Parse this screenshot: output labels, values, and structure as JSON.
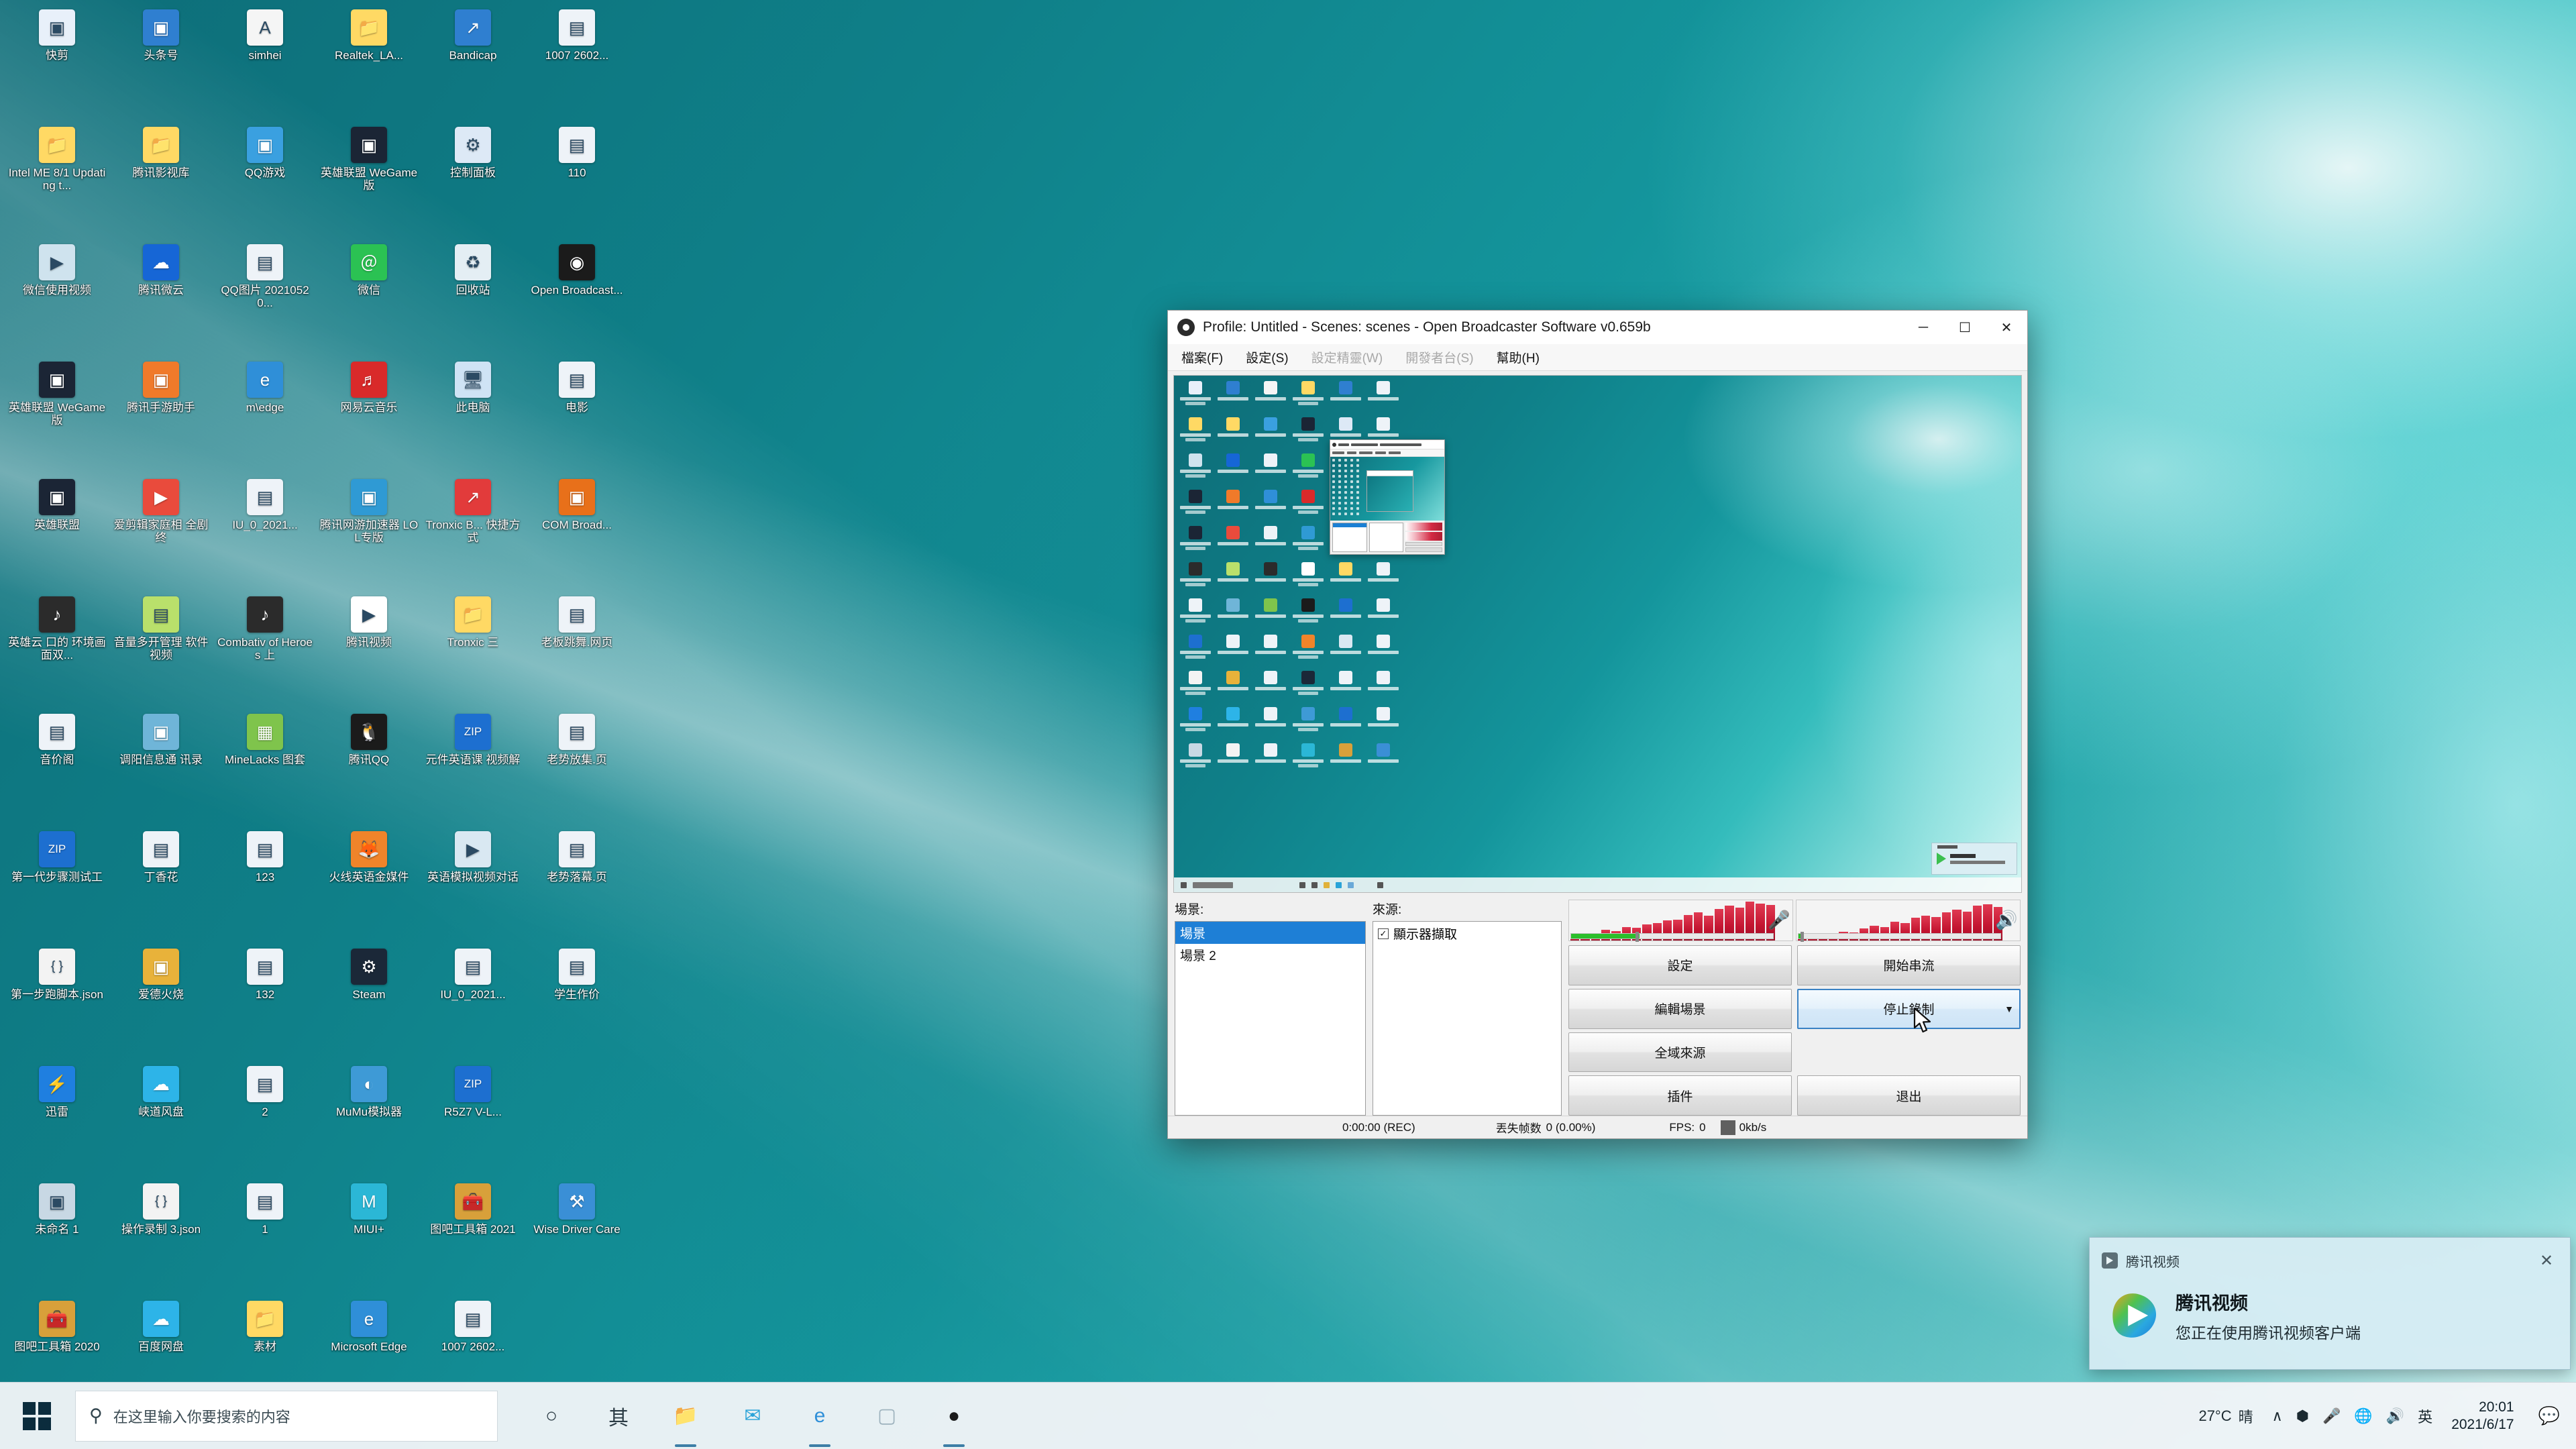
{
  "desktop": {
    "icons": [
      {
        "label": "快剪",
        "icon": "app-icon",
        "color": "#e8f0fa"
      },
      {
        "label": "头条号",
        "icon": "app-icon",
        "color": "#2f7fd0"
      },
      {
        "label": "simhei",
        "icon": "font-file-icon",
        "color": "#f5f5f5"
      },
      {
        "label": "Realtek_LA...",
        "icon": "folder-icon",
        "color": "#ffd964"
      },
      {
        "label": "Bandicap",
        "icon": "shortcut-icon",
        "color": "#2f7fd0"
      },
      {
        "label": "1007 2602...",
        "icon": "image-file-icon",
        "color": "#eef3f8"
      },
      {
        "label": "Intel ME 8/1 Updating t...",
        "icon": "folder-icon",
        "color": "#ffd964"
      },
      {
        "label": "腾讯影视库",
        "icon": "folder-icon",
        "color": "#ffd964"
      },
      {
        "label": "QQ游戏",
        "icon": "app-icon",
        "color": "#3aa0e0"
      },
      {
        "label": "英雄联盟 WeGame版",
        "icon": "app-icon",
        "color": "#1b2535"
      },
      {
        "label": "控制面板",
        "icon": "control-panel-icon",
        "color": "#dde9f6"
      },
      {
        "label": "110",
        "icon": "image-file-icon",
        "color": "#eef3f8"
      },
      {
        "label": "微信使用视频",
        "icon": "video-file-icon",
        "color": "#cfe3ee"
      },
      {
        "label": "腾讯微云",
        "icon": "cloud-icon",
        "color": "#1666d6"
      },
      {
        "label": "QQ图片 20210520...",
        "icon": "image-file-icon",
        "color": "#eef3f8"
      },
      {
        "label": "微信",
        "icon": "wechat-icon",
        "color": "#2bc253"
      },
      {
        "label": "回收站",
        "icon": "recycle-bin-icon",
        "color": "#e4eef4"
      },
      {
        "label": "Open Broadcast...",
        "icon": "obs-icon",
        "color": "#1b1b1b"
      },
      {
        "label": "英雄联盟 WeGame版",
        "icon": "app-icon",
        "color": "#1b2535"
      },
      {
        "label": "腾讯手游助手",
        "icon": "app-icon",
        "color": "#f07a2a"
      },
      {
        "label": "m\\edge",
        "icon": "edge-icon",
        "color": "#2f8fd8"
      },
      {
        "label": "网易云音乐",
        "icon": "netease-music-icon",
        "color": "#d92a2a"
      },
      {
        "label": "此电脑",
        "icon": "this-pc-icon",
        "color": "#cfe3f5"
      },
      {
        "label": "电影",
        "icon": "image-file-icon",
        "color": "#eef3f8"
      },
      {
        "label": "英雄联盟",
        "icon": "app-icon",
        "color": "#1b2535"
      },
      {
        "label": "爱剪辑家庭相 全剧终",
        "icon": "video-file-icon",
        "color": "#e94b3c"
      },
      {
        "label": "IU_0_2021...",
        "icon": "image-file-icon",
        "color": "#eef3f8"
      },
      {
        "label": "腾讯网游加速器 LOL专版",
        "icon": "app-icon",
        "color": "#2f9ad4"
      },
      {
        "label": "Tronxic B... 快捷方式",
        "icon": "shortcut-icon",
        "color": "#e23b3b"
      },
      {
        "label": "COM Broad...",
        "icon": "app-icon",
        "color": "#e8701a"
      },
      {
        "label": "英雄云 口的 环境画面双...",
        "icon": "mp3-file-icon",
        "color": "#2b2b2b"
      },
      {
        "label": "音量多开管理 软件视频",
        "icon": "image-file-icon",
        "color": "#b9e06b"
      },
      {
        "label": "Combativ of Heroes 上",
        "icon": "mp3-file-icon",
        "color": "#2b2b2b"
      },
      {
        "label": "腾讯视频",
        "icon": "tencent-video-icon",
        "color": "#ffffff"
      },
      {
        "label": "Tronxic 三",
        "icon": "folder-icon",
        "color": "#ffd964"
      },
      {
        "label": "老板跳舞.网页",
        "icon": "image-file-icon",
        "color": "#eef3f8"
      },
      {
        "label": "音价阁",
        "icon": "image-file-icon",
        "color": "#eef3f8"
      },
      {
        "label": "调阳信息通 讯录",
        "icon": "app-icon",
        "color": "#6fb5d8"
      },
      {
        "label": "MineLacks 图套",
        "icon": "minecraft-icon",
        "color": "#7fc44c"
      },
      {
        "label": "腾讯QQ",
        "icon": "qq-icon",
        "color": "#1b1b1b"
      },
      {
        "label": "元件英语课 视频解",
        "icon": "zip-file-icon",
        "color": "#1d6fd0"
      },
      {
        "label": "老势放集.页",
        "icon": "image-file-icon",
        "color": "#eef3f8"
      },
      {
        "label": "第一代步骤测试工",
        "icon": "zip-file-icon",
        "color": "#1d6fd0"
      },
      {
        "label": "丁香花",
        "icon": "image-file-icon",
        "color": "#eef3f8"
      },
      {
        "label": "123",
        "icon": "image-file-icon",
        "color": "#eef3f8"
      },
      {
        "label": "火线英语金媒件",
        "icon": "firefox-icon",
        "color": "#f0842a"
      },
      {
        "label": "英语模拟视频对话",
        "icon": "video-file-icon",
        "color": "#d9e8f2"
      },
      {
        "label": "老势落幕.页",
        "icon": "image-file-icon",
        "color": "#eef3f8"
      },
      {
        "label": "第一步跑脚本.json",
        "icon": "json-file-icon",
        "color": "#f3f3f3"
      },
      {
        "label": "爱德火烧",
        "icon": "app-icon",
        "color": "#e8b23a"
      },
      {
        "label": "132",
        "icon": "image-file-icon",
        "color": "#eef3f8"
      },
      {
        "label": "Steam",
        "icon": "steam-icon",
        "color": "#1b2838"
      },
      {
        "label": "IU_0_2021...",
        "icon": "image-file-icon",
        "color": "#eef3f8"
      },
      {
        "label": "学生作价",
        "icon": "image-file-icon",
        "color": "#eef3f8"
      },
      {
        "label": "迅雷",
        "icon": "thunder-icon",
        "color": "#1f7fe0"
      },
      {
        "label": "峡道风盘",
        "icon": "baidu-netdisk-icon",
        "color": "#2db4e8"
      },
      {
        "label": "2",
        "icon": "image-file-icon",
        "color": "#eef3f8"
      },
      {
        "label": "MuMu模拟器",
        "icon": "mumu-icon",
        "color": "#3e9ad6"
      },
      {
        "label": "R5Z7 V-L...",
        "icon": "zip-file-icon",
        "color": "#1d6fd0"
      },
      {
        "label": "",
        "icon": "blank-icon",
        "color": "transparent"
      },
      {
        "label": "未命名 1",
        "icon": "app-icon",
        "color": "#c8d8e4"
      },
      {
        "label": "操作录制 3.json",
        "icon": "json-file-icon",
        "color": "#f3f3f3"
      },
      {
        "label": "1",
        "icon": "image-file-icon",
        "color": "#eef3f8"
      },
      {
        "label": "MIUI+",
        "icon": "miui-icon",
        "color": "#2bb7d6"
      },
      {
        "label": "图吧工具箱 2021",
        "icon": "toolbox-icon",
        "color": "#d8a03a"
      },
      {
        "label": "Wise Driver Care",
        "icon": "wise-driver-icon",
        "color": "#3a8fd6"
      },
      {
        "label": "图吧工具箱 2020",
        "icon": "toolbox-icon",
        "color": "#d8a03a"
      },
      {
        "label": "百度网盘",
        "icon": "baidu-netdisk-icon",
        "color": "#2db4e8"
      },
      {
        "label": "素材",
        "icon": "folder-icon",
        "color": "#ffd964"
      },
      {
        "label": "Microsoft Edge",
        "icon": "edge-icon",
        "color": "#2f8fd8"
      },
      {
        "label": "1007 2602...",
        "icon": "image-file-icon",
        "color": "#eef3f8"
      }
    ]
  },
  "obs": {
    "title": "Profile: Untitled - Scenes: scenes - Open Broadcaster Software v0.659b",
    "window_buttons": {
      "minimize": "─",
      "maximize": "☐",
      "close": "✕"
    },
    "menu": [
      {
        "label": "檔案(F)",
        "disabled": false
      },
      {
        "label": "設定(S)",
        "disabled": false
      },
      {
        "label": "設定精靈(W)",
        "disabled": true
      },
      {
        "label": "開發者台(S)",
        "disabled": true
      },
      {
        "label": "幫助(H)",
        "disabled": false
      }
    ],
    "scenes": {
      "label": "場景:",
      "items": [
        {
          "name": "場景",
          "selected": true
        },
        {
          "name": "場景 2",
          "selected": false
        }
      ]
    },
    "sources": {
      "label": "來源:",
      "items": [
        {
          "name": "顯示器擷取",
          "checked": true,
          "check_glyph": "✓"
        }
      ]
    },
    "buttons": {
      "settings": "設定",
      "start_stream": "開始串流",
      "edit_scene": "編輯場景",
      "stop_record": "停止錄制",
      "global_sources": "全域來源",
      "plugins": "插件",
      "exit": "退出",
      "dropdown_caret": "▼"
    },
    "meters": {
      "mic_icon": "microphone-icon",
      "speaker_icon": "speaker-icon",
      "mic_glyph": "🎤",
      "speaker_glyph": "🔊"
    },
    "status": {
      "rec_time": "0:00:00 (REC)",
      "dropped_label": "丟失帧数",
      "dropped_value": "0 (0.00%)",
      "fps_label": "FPS:",
      "fps_value": "0",
      "bitrate": "0kb/s"
    }
  },
  "toast": {
    "app_name": "腾讯视频",
    "title": "腾讯视频",
    "description": "您正在使用腾讯视频客户端",
    "close_glyph": "✕"
  },
  "taskbar": {
    "start_label": "start-button",
    "search_placeholder": "在这里输入你要搜索的内容",
    "search_icon": "search-icon",
    "items": [
      {
        "name": "cortana-icon",
        "glyph": "○",
        "color": "#2b3b44",
        "running": false
      },
      {
        "name": "task-view-icon",
        "glyph": "其",
        "color": "#2b3b44",
        "running": false
      },
      {
        "name": "file-explorer-icon",
        "glyph": "📁",
        "color": "#ffc83d",
        "running": true
      },
      {
        "name": "mail-icon",
        "glyph": "✉",
        "color": "#2aa3d8",
        "running": false
      },
      {
        "name": "edge-icon",
        "glyph": "e",
        "color": "#2f8fd8",
        "running": true
      },
      {
        "name": "store-icon",
        "glyph": "▢",
        "color": "#9db2bd",
        "running": false
      },
      {
        "name": "obs-icon",
        "glyph": "●",
        "color": "#1b1b1b",
        "running": true
      }
    ],
    "tray": {
      "weather_temp": "27°C",
      "weather_text": "晴",
      "icons": [
        {
          "name": "chevron-up-icon",
          "glyph": "∧"
        },
        {
          "name": "bluetooth-icon",
          "glyph": "⬢"
        },
        {
          "name": "microphone-icon",
          "glyph": "🎤"
        },
        {
          "name": "network-icon",
          "glyph": "🌐"
        },
        {
          "name": "volume-icon",
          "glyph": "🔊"
        },
        {
          "name": "ime-icon",
          "glyph": "英"
        }
      ],
      "clock_time": "20:01",
      "clock_date": "2021/6/17",
      "action_center_glyph": "💬"
    }
  }
}
